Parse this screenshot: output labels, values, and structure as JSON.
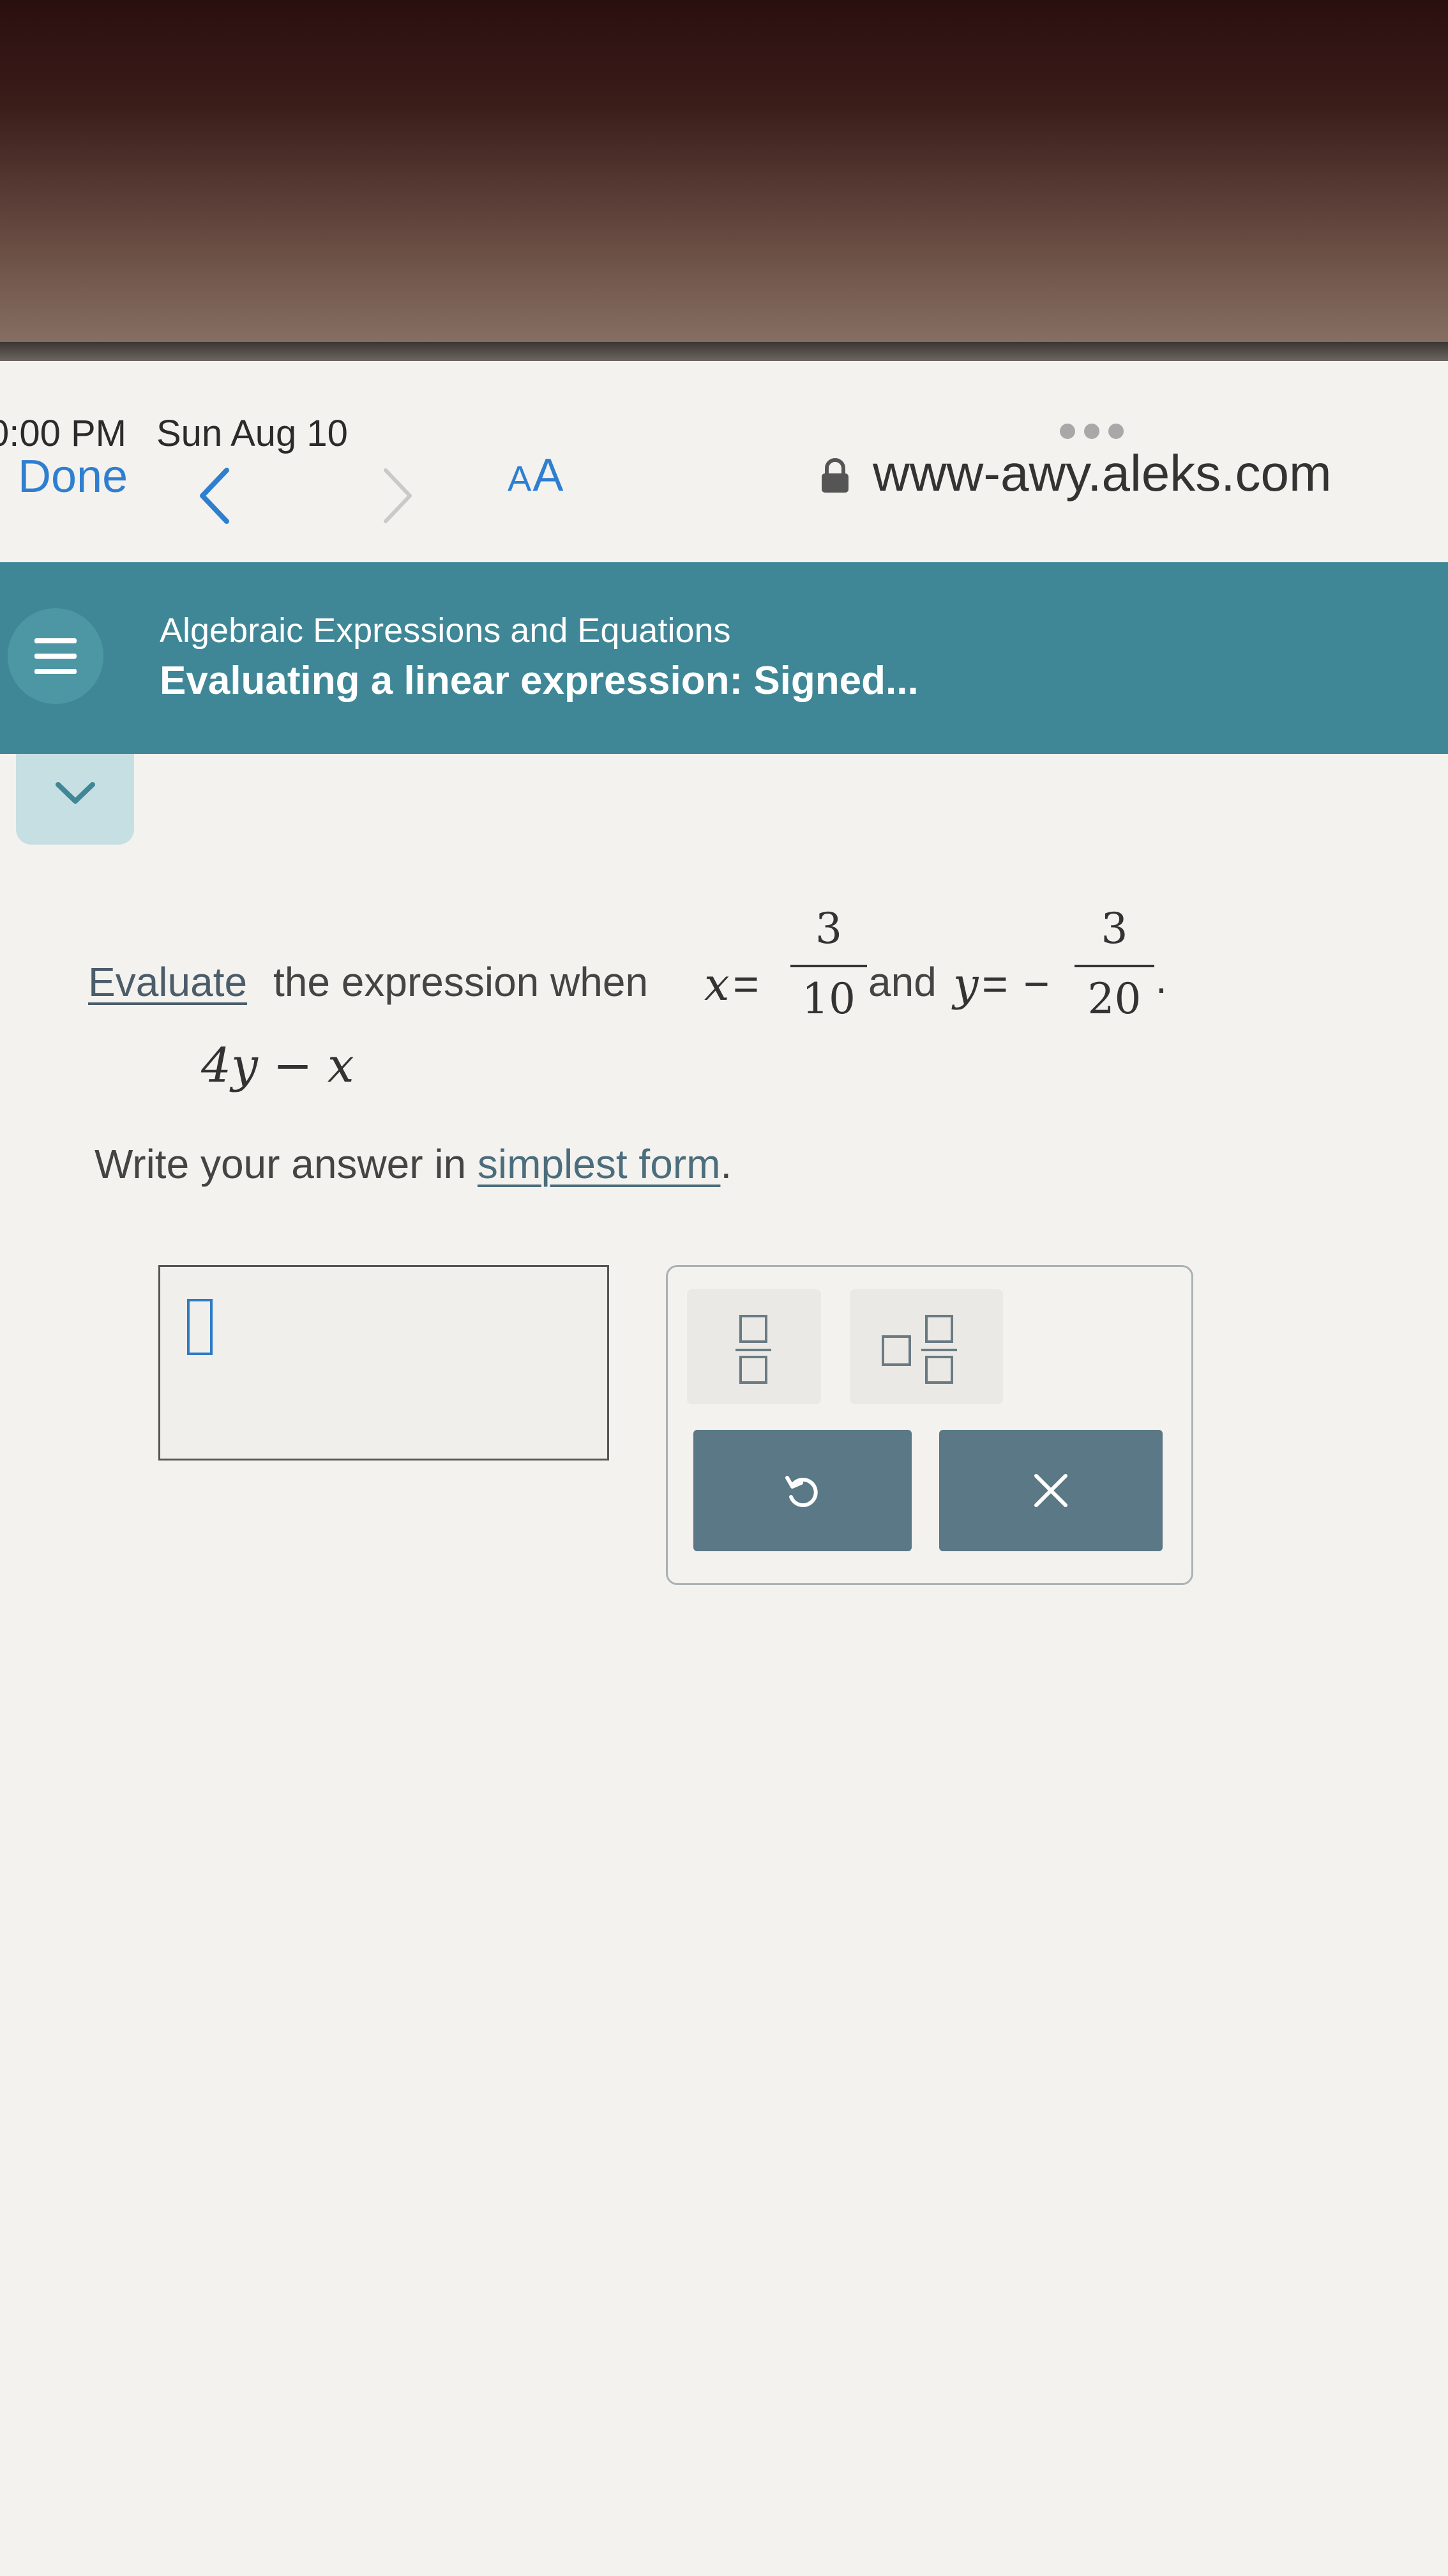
{
  "status_bar": {
    "time": "0:00 PM",
    "date": "Sun Aug 10"
  },
  "browser": {
    "done_label": "Done",
    "reader_label_small": "A",
    "reader_label_large": "A",
    "url": "www-awy.aleks.com"
  },
  "header": {
    "category": "Algebraic Expressions and Equations",
    "title": "Evaluating a linear expression: Signed...",
    "accent_color": "#3f8796"
  },
  "problem": {
    "evaluate_link": "Evaluate",
    "instruction_text": "the expression when",
    "var_x": "x",
    "equals": "=",
    "x_numerator": "3",
    "x_denominator": "10",
    "and_text": "and",
    "var_y": "y",
    "y_sign": "−",
    "y_numerator": "3",
    "y_denominator": "20",
    "period": ".",
    "expression": "4y − x",
    "answer_prompt_start": "Write your answer in",
    "simplest_form_link": "simplest form",
    "answer_prompt_end": "."
  },
  "tools": {
    "fraction_icon": "fraction-template-icon",
    "mixed_number_icon": "mixed-number-template-icon",
    "undo_icon": "undo-icon",
    "clear_icon": "close-icon"
  }
}
